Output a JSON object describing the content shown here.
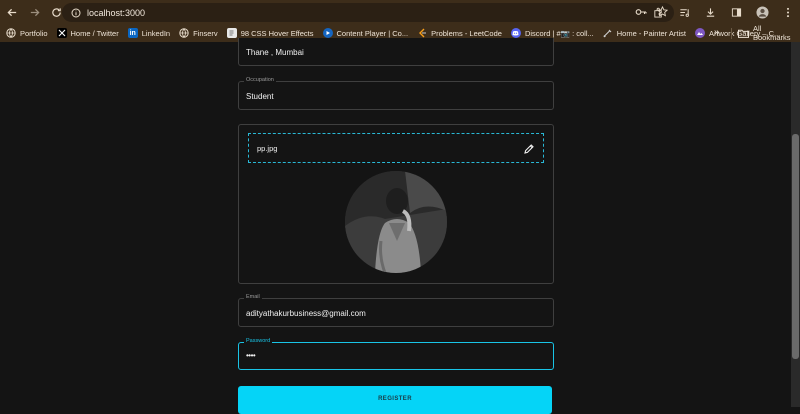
{
  "browser": {
    "url": "localhost:3000",
    "bookmarks": [
      {
        "label": "Portfolio",
        "icon": "globe-icon",
        "color": "#8a8a8a"
      },
      {
        "label": "Home / Twitter",
        "icon": "x-logo-icon",
        "color": "#000000"
      },
      {
        "label": "LinkedIn",
        "icon": "linkedin-icon",
        "color": "#0a66c2"
      },
      {
        "label": "Finserv",
        "icon": "globe-icon",
        "color": "#8a8a8a"
      },
      {
        "label": "98 CSS Hover Effects",
        "icon": "page-icon",
        "color": "#dddddd"
      },
      {
        "label": "Content Player | Co...",
        "icon": "player-icon",
        "color": "#1565c0"
      },
      {
        "label": "Problems - LeetCode",
        "icon": "leetcode-icon",
        "color": "#f89f1b"
      },
      {
        "label": "Discord | #📷 : coll...",
        "icon": "discord-icon",
        "color": "#5865f2"
      },
      {
        "label": "Home - Painter Artist",
        "icon": "brush-icon",
        "color": "#cfcfcf"
      },
      {
        "label": "Artwork Gallery – C...",
        "icon": "gallery-icon",
        "color": "#7e57c2"
      }
    ],
    "more_label": "»",
    "all_bookmarks_label": "All Bookmarks"
  },
  "form": {
    "location_value": "Thane , Mumbai",
    "occupation_label": "Occupation",
    "occupation_value": "Student",
    "upload_filename": "pp.jpg",
    "email_label": "Email",
    "email_value": "adityathakurbusiness@gmail.com",
    "password_label": "Password",
    "password_value": "••••",
    "register_label": "REGISTER"
  },
  "colors": {
    "accent": "#05d4f7",
    "background": "#141414",
    "chrome": "#3d2d1a"
  }
}
